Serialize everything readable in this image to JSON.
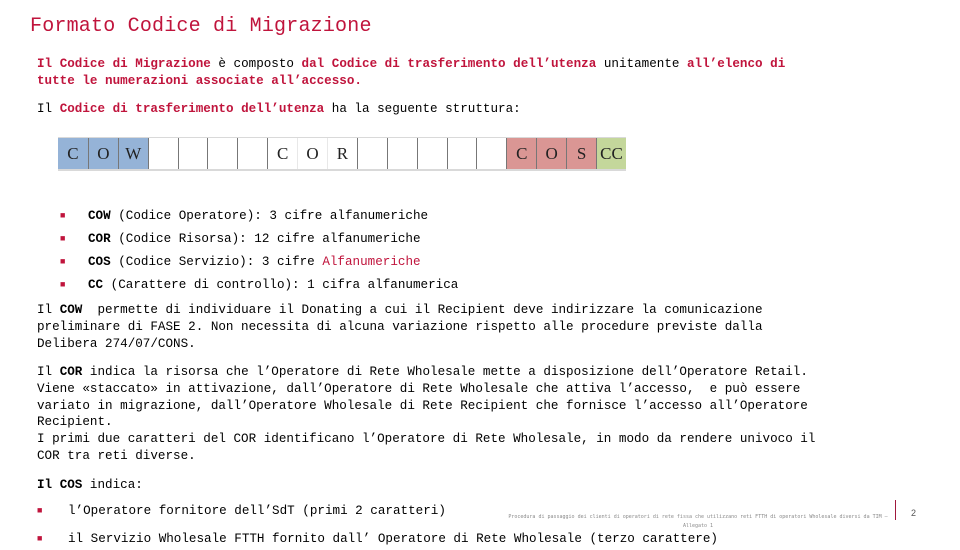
{
  "title": "Formato Codice di Migrazione",
  "intro": {
    "p1": [
      {
        "t": "Il ",
        "s": "red"
      },
      {
        "t": "Codice di Migrazione",
        "s": "red"
      },
      {
        "t": " è composto ",
        "s": "plain"
      },
      {
        "t": "dal Codice di trasferimento dell’utenza",
        "s": "red"
      },
      {
        "t": " unitamente ",
        "s": "plain"
      },
      {
        "t": "all’elenco di",
        "s": "red"
      },
      {
        "t": "\ntutte le numerazioni associate all’accesso.",
        "s": "red"
      }
    ],
    "p2_pre": "Il ",
    "p2_red": "Codice di trasferimento dell’utenza",
    "p2_post": " ha la seguente struttura:"
  },
  "code_structure": {
    "cells": [
      {
        "label": "C",
        "group": "COW",
        "color": "#95b3d7"
      },
      {
        "label": "O",
        "group": "COW",
        "color": "#95b3d7"
      },
      {
        "label": "W",
        "group": "COW",
        "color": "#95b3d7"
      },
      {
        "label": "",
        "group": "COR"
      },
      {
        "label": "",
        "group": "COR"
      },
      {
        "label": "",
        "group": "COR"
      },
      {
        "label": "",
        "group": "COR"
      },
      {
        "label": "C",
        "group": "COR"
      },
      {
        "label": "O",
        "group": "COR"
      },
      {
        "label": "R",
        "group": "COR"
      },
      {
        "label": "",
        "group": "COR"
      },
      {
        "label": "",
        "group": "COR"
      },
      {
        "label": "",
        "group": "COR"
      },
      {
        "label": "",
        "group": "COR"
      },
      {
        "label": "",
        "group": "COR"
      },
      {
        "label": "C",
        "group": "COS",
        "color": "#da9694"
      },
      {
        "label": "O",
        "group": "COS",
        "color": "#da9694"
      },
      {
        "label": "S",
        "group": "COS",
        "color": "#da9694"
      },
      {
        "label": "CC",
        "group": "CC",
        "color": "#c4d79b"
      }
    ]
  },
  "fields": [
    {
      "code": "COW",
      "desc": " (Codice Operatore): 3 cifre alfanumeriche",
      "extra": ""
    },
    {
      "code": "COR",
      "desc": " (Codice Risorsa): 12 cifre alfanumeriche",
      "extra": ""
    },
    {
      "code": "COS",
      "desc": " (Codice Servizio): 3 cifre ",
      "extra": "Alfanumeriche"
    },
    {
      "code": "CC",
      "desc": " (Carattere di controllo): 1 cifra alfanumerica",
      "extra": ""
    }
  ],
  "cow_paragraph": {
    "pre": "Il ",
    "code": "COW",
    "text": "  permette di individuare il Donating a cui il Recipient deve indirizzare la comunicazione\npreliminare di FASE 2. Non necessita di alcuna variazione rispetto alle procedure previste dalla\nDelibera 274/07/CONS."
  },
  "cor_paragraph": {
    "pre": "Il ",
    "code": "COR",
    "text": " indica la risorsa che l’Operatore di Rete Wholesale mette a disposizione dell’Operatore Retail.\nViene «staccato» in attivazione, dall’Operatore di Rete Wholesale che attiva l’accesso,  e può essere\nvariato in migrazione, dall’Operatore Wholesale di Rete Recipient che fornisce l’accesso all’Operatore\nRecipient.\nI primi due caratteri del COR identificano l’Operatore di Rete Wholesale, in modo da rendere univoco il\nCOR tra reti diverse."
  },
  "cos_paragraph": {
    "heading_pre": "Il ",
    "heading_code": "COS",
    "heading_post": " indica:",
    "items": [
      "l’Operatore fornitore dell’SdT (primi 2 caratteri)",
      "il Servizio Wholesale FTTH fornito dall’ Operatore di Rete Wholesale (terzo carattere)"
    ]
  },
  "footer": {
    "text": "Procedura di passaggio dei clienti di operatori di rete fissa che utilizzano reti FTTH di operatori Wholesale diversi da TIM – Allegato 1",
    "page_number": "2"
  },
  "colors": {
    "accent": "#c0143c",
    "cow": "#95b3d7",
    "cos": "#da9694",
    "cc": "#c4d79b"
  }
}
